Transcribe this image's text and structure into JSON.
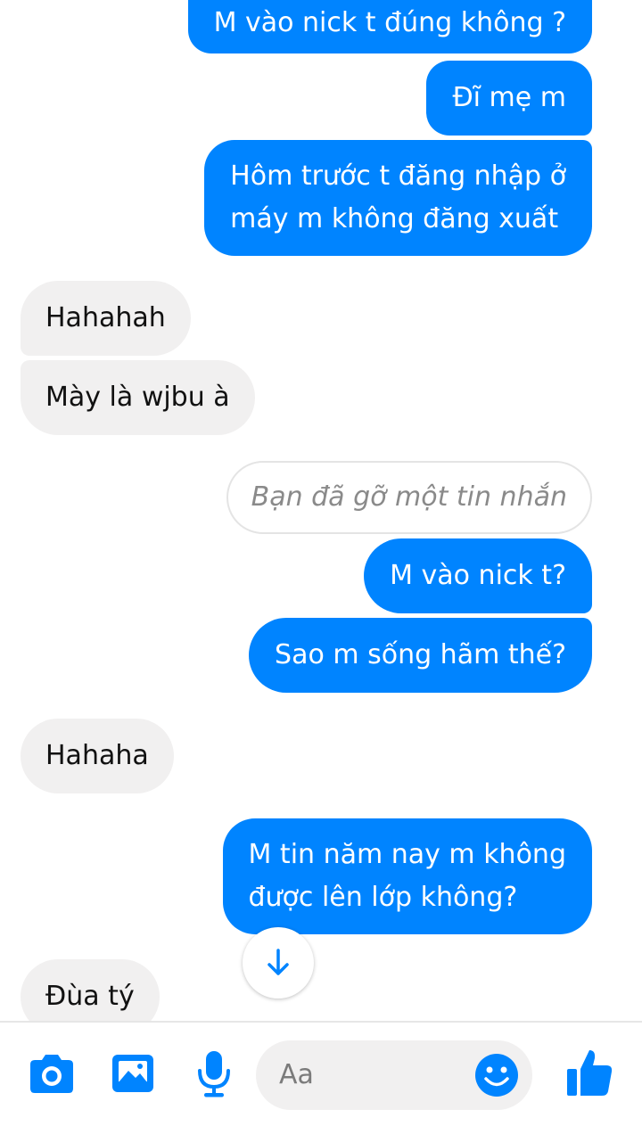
{
  "messages": [
    {
      "direction": "outgoing",
      "text": "M vào nick t đúng không ?"
    },
    {
      "direction": "outgoing",
      "text": "Đĩ mẹ m"
    },
    {
      "direction": "outgoing",
      "lines": [
        "Hôm trước t đăng nhập ở",
        "máy m không đăng xuất"
      ]
    },
    {
      "direction": "incoming",
      "text": "Hahahah"
    },
    {
      "direction": "incoming",
      "text": "Mày là wjbu à"
    },
    {
      "direction": "outgoing",
      "type": "removed",
      "text": "Bạn đã gỡ một tin nhắn"
    },
    {
      "direction": "outgoing",
      "text": "M vào nick t?"
    },
    {
      "direction": "outgoing",
      "text": "Sao m sống hãm thế?"
    },
    {
      "direction": "incoming",
      "text": "Hahaha"
    },
    {
      "direction": "outgoing",
      "lines": [
        "M tin năm nay m không",
        "được lên lớp không?"
      ]
    },
    {
      "direction": "incoming",
      "text": "Đùa tý"
    }
  ],
  "composer": {
    "placeholder": "Aa",
    "icons": [
      "camera-icon",
      "gallery-icon",
      "microphone-icon",
      "emoji-icon",
      "like-icon"
    ]
  },
  "colors": {
    "accent": "#0084ff",
    "incoming_bubble": "#f1f0f0"
  }
}
